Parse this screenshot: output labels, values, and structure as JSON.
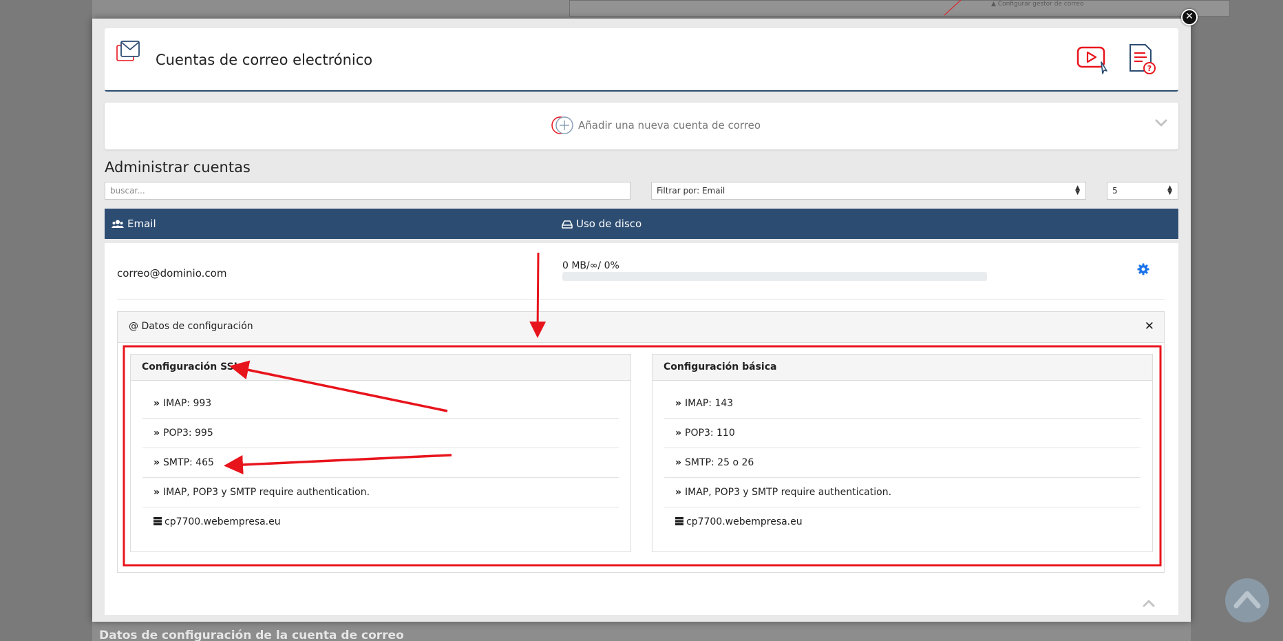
{
  "background": {
    "link_text": "Configurar gestor de correo",
    "footer_title": "Datos de configuración de la cuenta de correo"
  },
  "header": {
    "title": "Cuentas de correo electrónico",
    "icons": [
      "email-accounts-icon",
      "youtube-video-icon",
      "help-document-icon"
    ]
  },
  "add_account": {
    "label": "Añadir una nueva cuenta de correo"
  },
  "manage": {
    "title": "Administrar cuentas",
    "search_placeholder": "buscar...",
    "filter_value": "Filtrar por: Email",
    "per_page_value": "5"
  },
  "table": {
    "columns": [
      "Email",
      "Uso de disco"
    ]
  },
  "account": {
    "email": "correo@dominio.com",
    "usage_text": "0 MB/∞/ 0%",
    "usage_fraction": 0
  },
  "config": {
    "title": "@ Datos de configuración",
    "ssl": {
      "title": "Configuración SSL",
      "items": [
        "IMAP: 993",
        "POP3: 995",
        "SMTP: 465",
        "IMAP, POP3 y SMTP require authentication."
      ],
      "server": "cp7700.webempresa.eu"
    },
    "basic": {
      "title": "Configuración básica",
      "items": [
        "IMAP: 143",
        "POP3: 110",
        "SMTP: 25 o 26",
        "IMAP, POP3 y SMTP require authentication."
      ],
      "server": "cp7700.webempresa.eu"
    }
  },
  "colors": {
    "accent": "#2c4c72",
    "annotation": "#e8141c",
    "gear": "#1a73e8"
  }
}
